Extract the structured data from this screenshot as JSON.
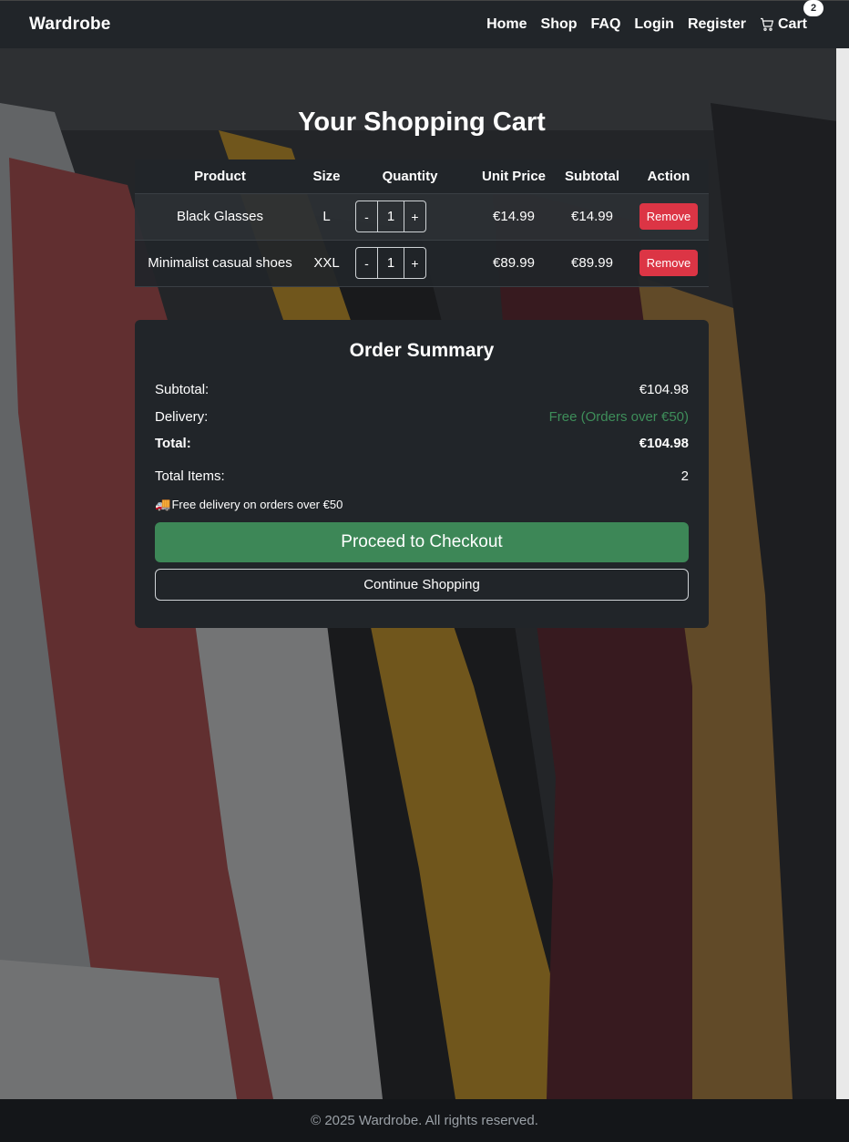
{
  "brand": "Wardrobe",
  "nav": {
    "home": "Home",
    "shop": "Shop",
    "faq": "FAQ",
    "login": "Login",
    "register": "Register",
    "cart": "Cart",
    "cart_count": "2"
  },
  "page_title": "Your Shopping Cart",
  "table": {
    "headers": [
      "Product",
      "Size",
      "Quantity",
      "Unit Price",
      "Subtotal",
      "Action"
    ],
    "rows": [
      {
        "product": "Black Glasses",
        "size": "L",
        "qty": "1",
        "unit_price": "€14.99",
        "subtotal": "€14.99",
        "action": "Remove",
        "minus": "-",
        "plus": "+"
      },
      {
        "product": "Minimalist casual shoes",
        "size": "XXL",
        "qty": "1",
        "unit_price": "€89.99",
        "subtotal": "€89.99",
        "action": "Remove",
        "minus": "-",
        "plus": "+"
      }
    ]
  },
  "summary": {
    "title": "Order Summary",
    "subtotal_label": "Subtotal:",
    "subtotal_value": "€104.98",
    "delivery_label": "Delivery:",
    "delivery_value": "Free (Orders over €50)",
    "total_label": "Total:",
    "total_value": "€104.98",
    "items_label": "Total Items:",
    "items_value": "2",
    "note": "Free delivery on orders over €50",
    "note_icon": "truck-icon",
    "checkout_label": "Proceed to Checkout",
    "continue_label": "Continue Shopping"
  },
  "footer": "© 2025 Wardrobe. All rights reserved.",
  "colors": {
    "navbar": "#212529",
    "remove": "#dc3545",
    "checkout": "#3d8757",
    "free_delivery": "#3e8e5a"
  }
}
